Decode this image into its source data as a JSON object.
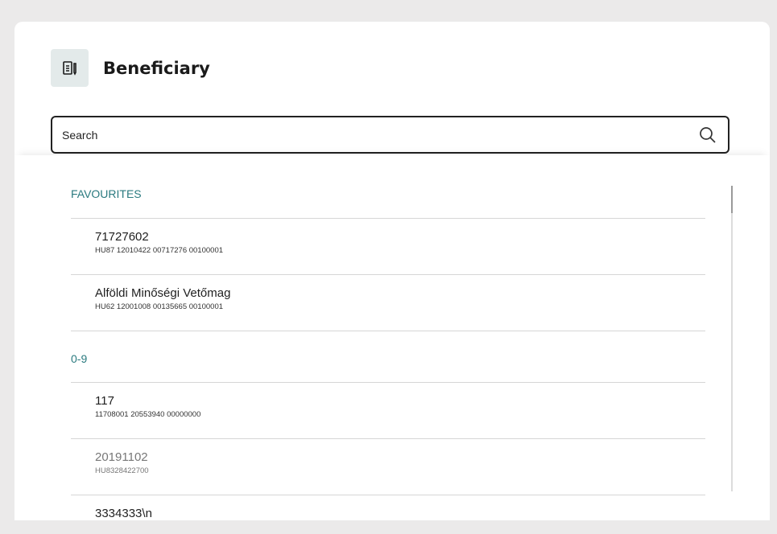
{
  "header": {
    "title": "Beneficiary",
    "icon": "document-pen-icon"
  },
  "search": {
    "placeholder": "Search"
  },
  "sections": {
    "favourites": {
      "label": "FAVOURITES",
      "items": [
        {
          "name": "71727602",
          "account": "HU87 12010422 00717276 00100001"
        },
        {
          "name": "Alföldi Minőségi Vetőmag",
          "account": "HU62 12001008 00135665 00100001"
        }
      ]
    },
    "numeric": {
      "label": "0-9",
      "items": [
        {
          "name": "117",
          "account": "11708001 20553940 00000000"
        },
        {
          "name": "20191102",
          "account": "HU8328422700"
        },
        {
          "name": "3334333\\n",
          "account": ""
        }
      ]
    }
  },
  "colors": {
    "section_header": "#2a7a7f",
    "icon_bg": "#e3eaea",
    "background": "#ebeaea"
  }
}
